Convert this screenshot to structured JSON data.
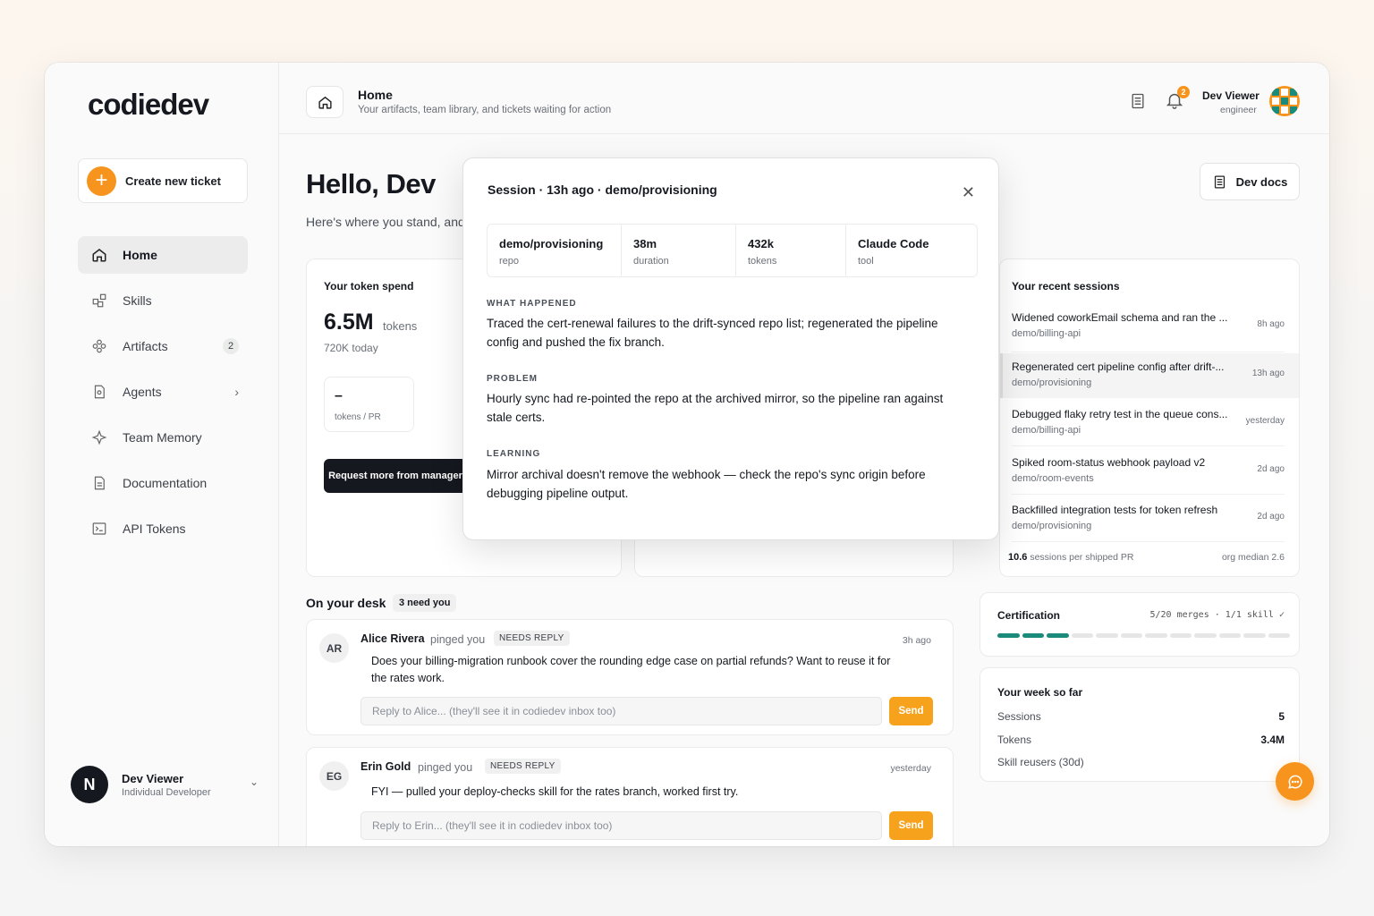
{
  "app": {
    "logo": "codiedev"
  },
  "sidebar": {
    "create_label": "Create new ticket",
    "items": [
      {
        "label": "Home",
        "icon": "home-icon"
      },
      {
        "label": "Skills",
        "icon": "skills-icon"
      },
      {
        "label": "Artifacts",
        "icon": "artifacts-icon",
        "badge": "2"
      },
      {
        "label": "Agents",
        "icon": "agents-icon"
      },
      {
        "label": "Team Memory",
        "icon": "sparkle-icon"
      },
      {
        "label": "Documentation",
        "icon": "document-icon"
      },
      {
        "label": "API Tokens",
        "icon": "terminal-icon"
      }
    ],
    "user": {
      "initial": "N",
      "name": "Dev Viewer",
      "role": "Individual Developer"
    }
  },
  "header": {
    "title": "Home",
    "subtitle": "Your artifacts, team library, and tickets waiting for action",
    "notif_count": "2",
    "user_name": "Dev Viewer",
    "user_role": "engineer"
  },
  "main": {
    "greeting": "Hello, Dev",
    "greeting_sub": "Here's where you stand, and",
    "dev_docs": "Dev docs",
    "token_card": {
      "title": "Your token spend",
      "big": "6.5M",
      "unit": "tokens",
      "today": "720K today",
      "mini_value": "–",
      "mini_label": "tokens / PR",
      "request_btn": "Request more from manager"
    },
    "sessions": {
      "title": "Your recent sessions",
      "items": [
        {
          "title": "Widened coworkEmail schema and ran the ...",
          "repo": "demo/billing-api",
          "when": "8h ago"
        },
        {
          "title": "Regenerated cert pipeline config after drift-...",
          "repo": "demo/provisioning",
          "when": "13h ago"
        },
        {
          "title": "Debugged flaky retry test in the queue cons...",
          "repo": "demo/billing-api",
          "when": "yesterday"
        },
        {
          "title": "Spiked room-status webhook payload v2",
          "repo": "demo/room-events",
          "when": "2d ago"
        },
        {
          "title": "Backfilled integration tests for token refresh",
          "repo": "demo/provisioning",
          "when": "2d ago"
        }
      ],
      "foot_value": "10.6",
      "foot_label": "sessions per shipped PR",
      "foot_right": "org median 2.6"
    },
    "certification": {
      "title": "Certification",
      "meta": "5/20 merges · 1/1 skill ✓",
      "progress_done": 3,
      "progress_total": 12,
      "accent": "#1a8a7a"
    },
    "week": {
      "title": "Your week so far",
      "rows": [
        {
          "label": "Sessions",
          "value": "5"
        },
        {
          "label": "Tokens",
          "value": "3.4M"
        },
        {
          "label": "Skill reusers (30d)",
          "value": ""
        }
      ]
    },
    "desk": {
      "title": "On your desk",
      "badge": "3 need you",
      "messages": [
        {
          "initials": "AR",
          "name": "Alice Rivera",
          "action": "pinged you",
          "tag": "NEEDS REPLY",
          "time": "3h ago",
          "body": "Does your billing-migration runbook cover the rounding edge case on partial refunds? Want to reuse it for the rates work.",
          "placeholder": "Reply to Alice... (they'll see it in codiedev inbox too)",
          "send": "Send"
        },
        {
          "initials": "EG",
          "name": "Erin Gold",
          "action": "pinged you",
          "tag": "NEEDS REPLY",
          "time": "yesterday",
          "body": "FYI — pulled your deploy-checks skill for the rates branch, worked first try.",
          "placeholder": "Reply to Erin... (they'll see it in codiedev inbox too)",
          "send": "Send"
        }
      ]
    }
  },
  "modal": {
    "title": "Session · 13h ago · demo/provisioning",
    "stats": [
      {
        "value": "demo/provisioning",
        "label": "repo"
      },
      {
        "value": "38m",
        "label": "duration"
      },
      {
        "value": "432k",
        "label": "tokens"
      },
      {
        "value": "Claude Code",
        "label": "tool"
      }
    ],
    "sections": [
      {
        "label": "WHAT HAPPENED",
        "text": "Traced the cert-renewal failures to the drift-synced repo list; regenerated the pipeline config and pushed the fix branch."
      },
      {
        "label": "PROBLEM",
        "text": "Hourly sync had re-pointed the repo at the archived mirror, so the pipeline ran against stale certs."
      },
      {
        "label": "LEARNING",
        "text": "Mirror archival doesn't remove the webhook — check the repo's sync origin before debugging pipeline output."
      }
    ]
  },
  "colors": {
    "brand": "#f7941d",
    "dark": "#15181f",
    "send": "#f7a21d"
  }
}
